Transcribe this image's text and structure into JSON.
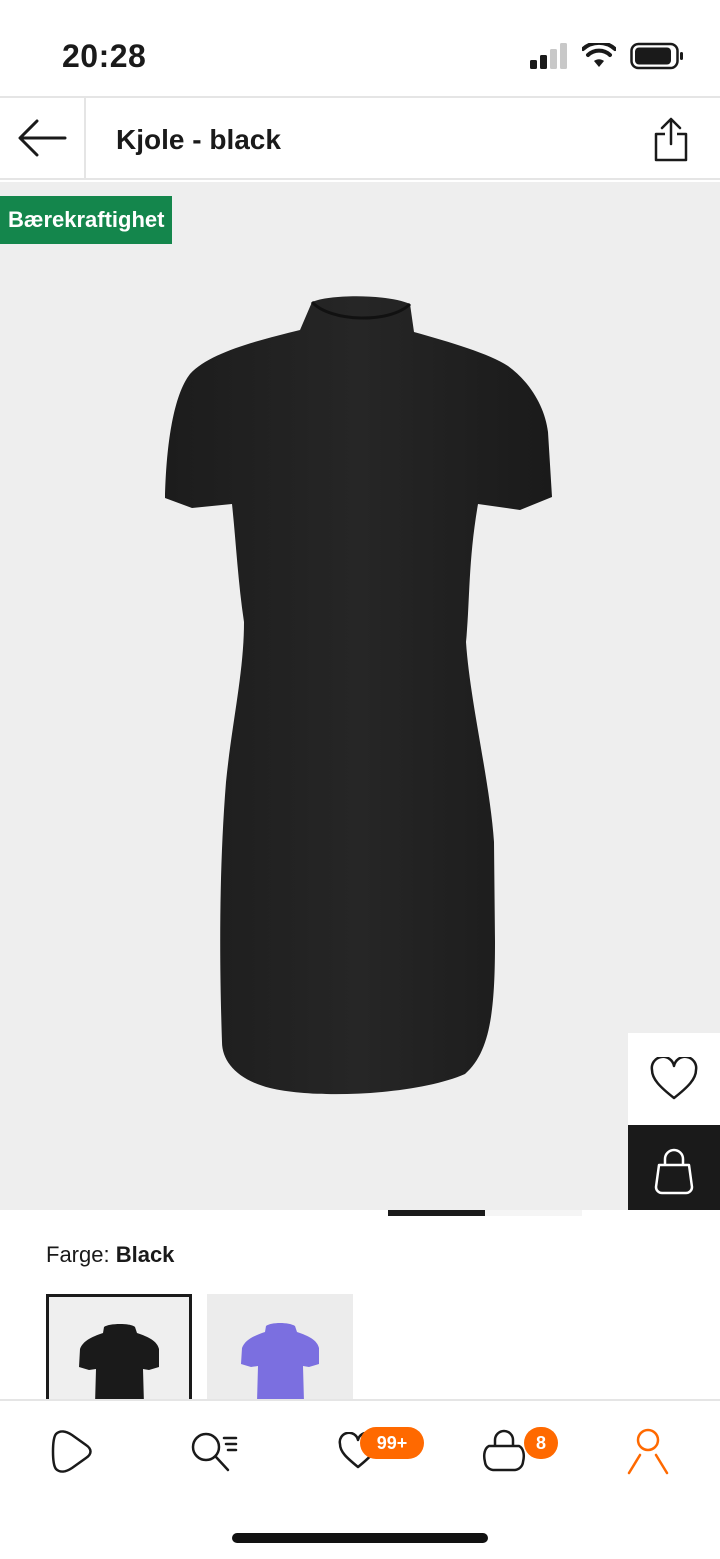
{
  "status_bar": {
    "time": "20:28"
  },
  "header": {
    "title": "Kjole - black"
  },
  "product": {
    "sustainability_badge": "Bærekraftighet",
    "carousel": {
      "total": 2,
      "active_index": 1
    }
  },
  "color": {
    "label": "Farge:",
    "selected": "Black",
    "swatches": [
      {
        "name": "black",
        "color": "#1a1a1a"
      },
      {
        "name": "purple",
        "color": "#7b6fe0"
      }
    ]
  },
  "nav": {
    "items": [
      {
        "name": "home",
        "icon": "play-logo-icon"
      },
      {
        "name": "search",
        "icon": "search-list-icon"
      },
      {
        "name": "wishlist",
        "icon": "heart-icon",
        "badge": "99+"
      },
      {
        "name": "bag",
        "icon": "bag-icon",
        "badge": "8"
      },
      {
        "name": "profile",
        "icon": "person-icon",
        "active": true
      }
    ]
  },
  "colors": {
    "accent": "#ff6900",
    "badge_green": "#14864c",
    "dark": "#1a1a1a"
  }
}
